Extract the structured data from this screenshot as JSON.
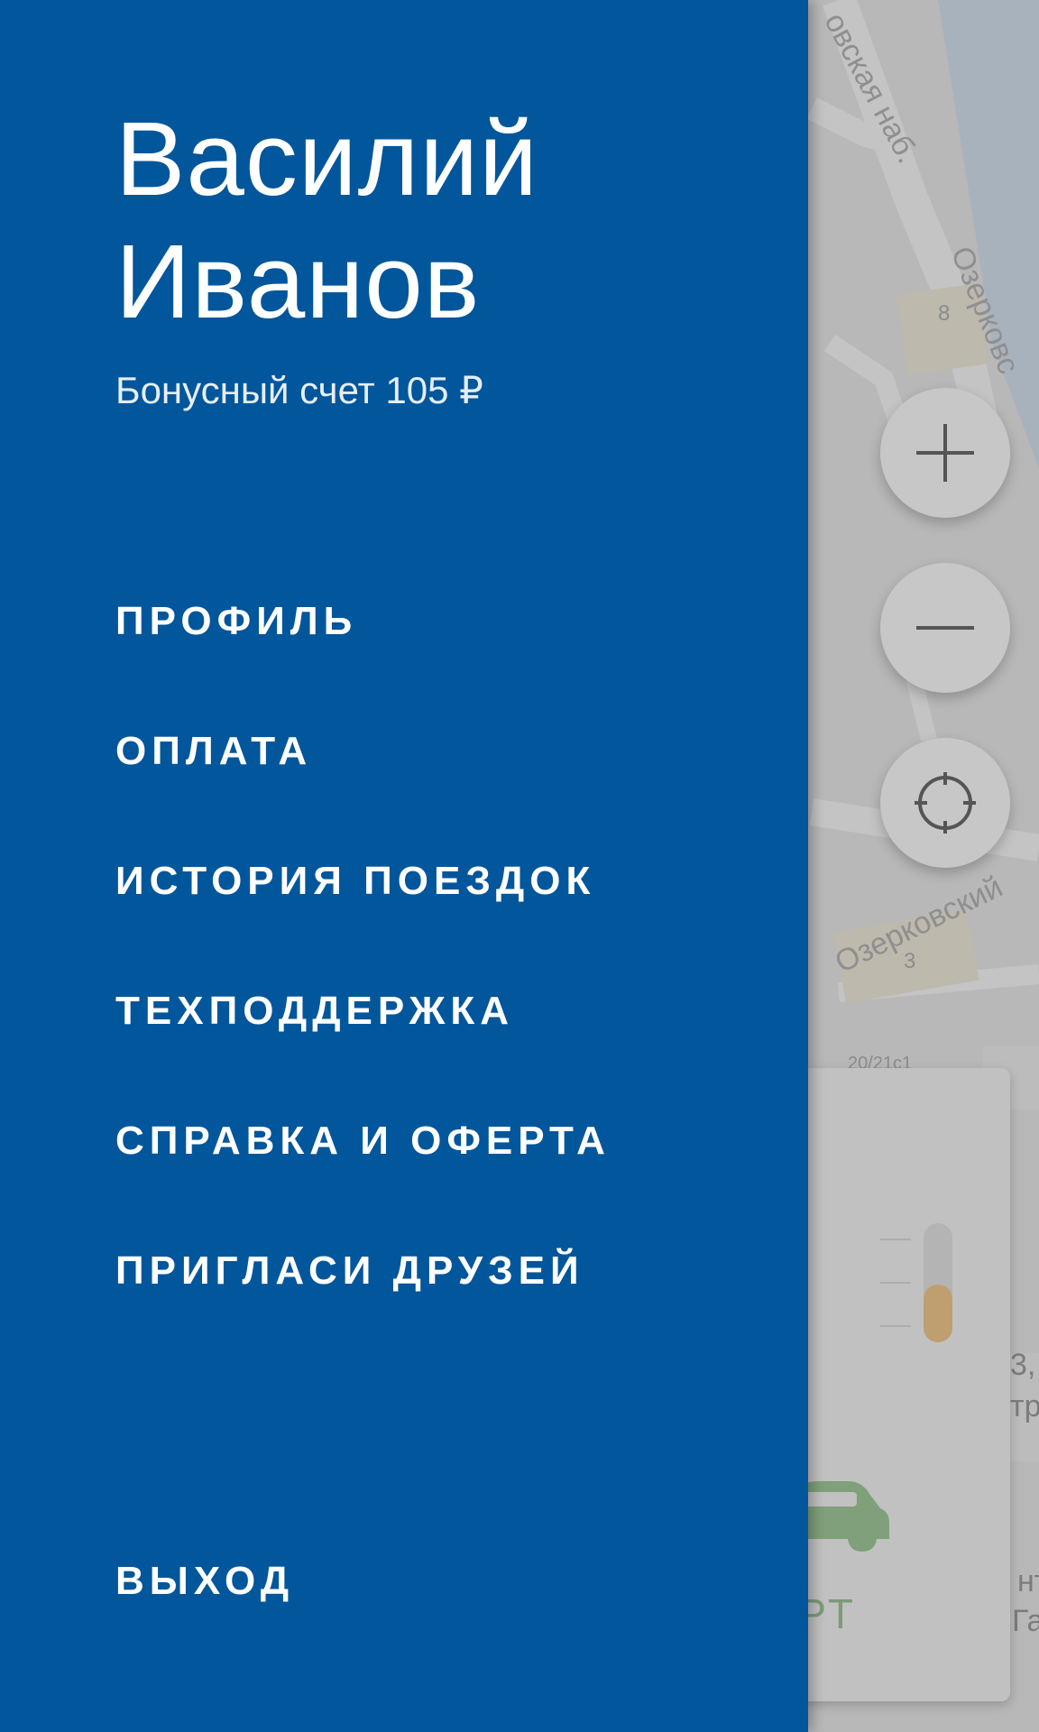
{
  "drawer": {
    "user": {
      "first_name": "Василий",
      "last_name": "Иванов"
    },
    "bonus_text": "Бонусный счет 105 ₽",
    "menu": [
      {
        "id": "profile",
        "label": "ПРОФИЛЬ"
      },
      {
        "id": "payment",
        "label": "ОПЛАТА"
      },
      {
        "id": "trip-history",
        "label": "ИСТОРИЯ ПОЕЗДОК"
      },
      {
        "id": "support",
        "label": "ТЕХПОДДЕРЖКА"
      },
      {
        "id": "help-offer",
        "label": "СПРАВКА И ОФЕРТА"
      },
      {
        "id": "invite-friends",
        "label": "ПРИГЛАСИ ДРУЗЕЙ"
      }
    ],
    "logout_label": "ВЫХОД"
  },
  "map": {
    "street_labels": [
      "овская наб.",
      "Озерковс",
      "Озерковский"
    ],
    "building_numbers": [
      "8",
      "3"
    ],
    "partial_label": "20/21с1",
    "edge_texts": [
      "3,",
      "тр",
      "нт",
      "Га"
    ],
    "controls": {
      "zoom_in_icon": "plus-icon",
      "zoom_out_icon": "minus-icon",
      "locate_icon": "crosshair-icon"
    }
  },
  "card": {
    "start_label": "ТАРТ"
  },
  "colors": {
    "drawer_bg": "#02569B",
    "text": "#FFFFFF",
    "map_scrim": "#B9B9B9"
  }
}
